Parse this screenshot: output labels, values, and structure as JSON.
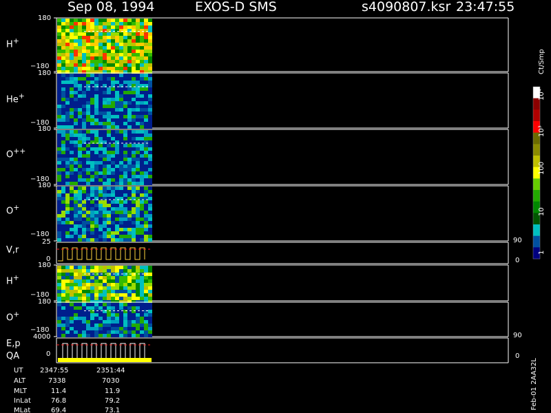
{
  "header": {
    "date": "Sep 08, 1994",
    "instrument": "EXOS-D SMS",
    "file": "s4090807.ksr",
    "time": "23:47:55"
  },
  "panels": [
    {
      "id": "h-plus-1",
      "label_main": "H",
      "label_sup": "+",
      "top_tick": "180",
      "bottom_tick": "−180"
    },
    {
      "id": "he-plus",
      "label_main": "He",
      "label_sup": "+",
      "top_tick": "180",
      "bottom_tick": "−180"
    },
    {
      "id": "o-plus-plus",
      "label_main": "O",
      "label_sup": "++",
      "top_tick": "180",
      "bottom_tick": "−180"
    },
    {
      "id": "o-plus-1",
      "label_main": "O",
      "label_sup": "+",
      "top_tick": "180",
      "bottom_tick": "−180"
    },
    {
      "id": "vr",
      "label_main": "V,r",
      "label_sup": "",
      "top_tick": "25",
      "bottom_tick": "0",
      "right_top": "90",
      "right_bottom": "0"
    },
    {
      "id": "h-plus-2",
      "label_main": "H",
      "label_sup": "+",
      "top_tick": "180",
      "bottom_tick": "−180"
    },
    {
      "id": "o-plus-2",
      "label_main": "O",
      "label_sup": "+",
      "top_tick": "180",
      "bottom_tick": "−180"
    },
    {
      "id": "ep-qa",
      "label_main": "E,p",
      "label_sub2": "QA",
      "top_tick": "4000",
      "bottom_tick": "0",
      "right_top": "90",
      "right_bottom": "0"
    }
  ],
  "colorbar": {
    "unit": "Ct/Smp",
    "labels": [
      "10⁴",
      "10³",
      "100",
      "10",
      "1"
    ],
    "stops": [
      "#ffffff",
      "#8b0000",
      "#b00000",
      "#ff0000",
      "#6b6b00",
      "#8b8b00",
      "#c0c000",
      "#ffff00",
      "#66cc00",
      "#22aa00",
      "#008800",
      "#005500",
      "#00c0c0",
      "#0050a0",
      "#000080"
    ]
  },
  "footer": {
    "rows": [
      {
        "name": "UT",
        "values": [
          "2347:55",
          "2351:44"
        ]
      },
      {
        "name": "ALT",
        "values": [
          "7338",
          "7030"
        ]
      },
      {
        "name": "MLT",
        "values": [
          "11.4",
          "11.9"
        ]
      },
      {
        "name": "InLat",
        "values": [
          "76.8",
          "79.2"
        ]
      },
      {
        "name": "MLat",
        "values": [
          "69.4",
          "73.1"
        ]
      }
    ],
    "stamp": "Feb-01 2AA32L"
  },
  "chart_data": {
    "type": "heatmap",
    "title": "Sep 08, 1994 EXOS-D SMS",
    "panels": [
      "H+",
      "He+",
      "O++",
      "O+",
      "V,r",
      "H+",
      "O+",
      "E,p QA"
    ],
    "xlabel": "UT",
    "x": [
      "2347:55",
      "2351:44"
    ],
    "ylim_pitch": [
      -180,
      180
    ],
    "vr_range": [
      0,
      25
    ],
    "energy_range": [
      0,
      4000
    ],
    "colorscale_range": [
      1,
      10000
    ],
    "colorscale_log": true,
    "unit": "Ct/Smp",
    "grid": false
  }
}
